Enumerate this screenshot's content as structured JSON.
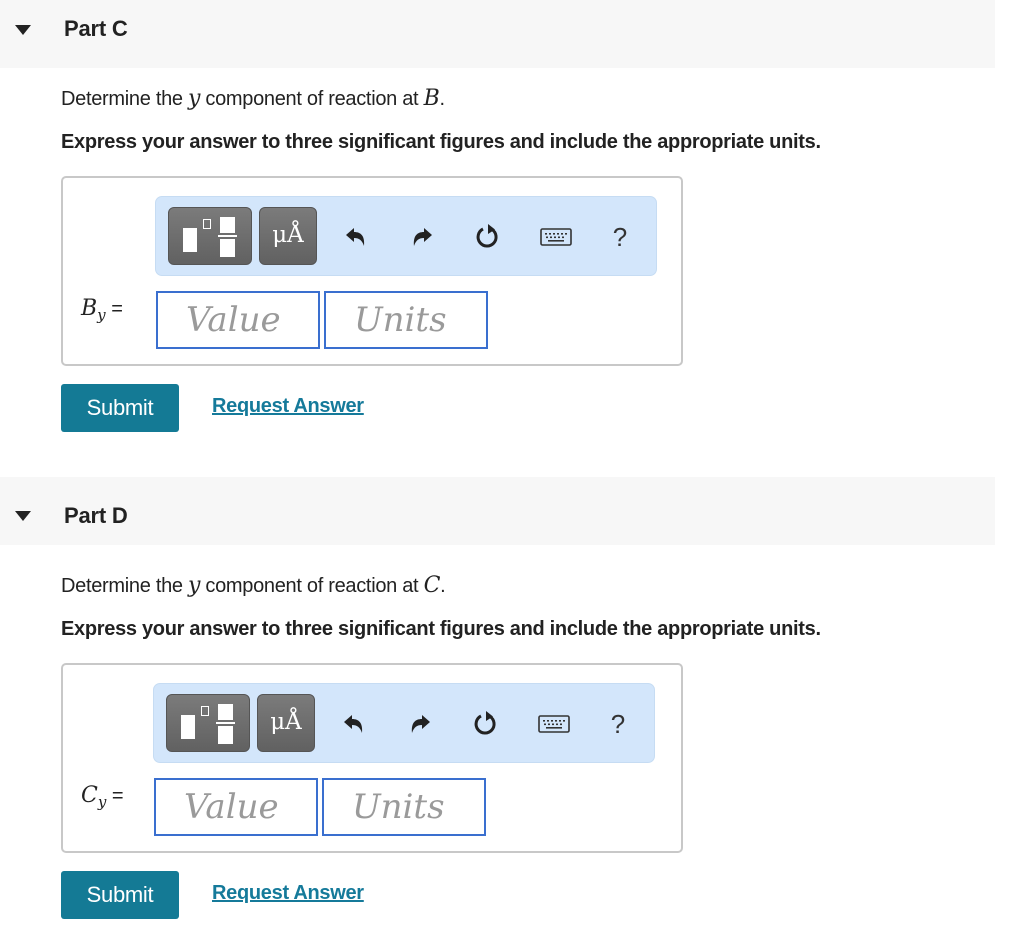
{
  "parts": [
    {
      "title": "Part C",
      "question_prefix": "Determine the ",
      "question_var": "y",
      "question_mid": " component of reaction at ",
      "question_point": "B",
      "question_suffix": ".",
      "instruction": "Express your answer to three significant figures and include the appropriate units.",
      "answer_label_var": "B",
      "answer_label_sub": "y",
      "answer_label_eq": "=",
      "value_placeholder": "Value",
      "units_placeholder": "Units",
      "submit_label": "Submit",
      "request_label": "Request Answer"
    },
    {
      "title": "Part D",
      "question_prefix": "Determine the ",
      "question_var": "y",
      "question_mid": " component of reaction at ",
      "question_point": "C",
      "question_suffix": ".",
      "instruction": "Express your answer to three significant figures and include the appropriate units.",
      "answer_label_var": "C",
      "answer_label_sub": "y",
      "answer_label_eq": "=",
      "value_placeholder": "Value",
      "units_placeholder": "Units",
      "submit_label": "Submit",
      "request_label": "Request Answer"
    }
  ],
  "toolbar": {
    "units_glyph": "μÅ",
    "help_glyph": "?",
    "icons": [
      "templates-icon",
      "units-icon",
      "undo-icon",
      "redo-icon",
      "reset-icon",
      "keyboard-icon",
      "help-icon"
    ]
  },
  "colors": {
    "submit_bg": "#147a95",
    "link": "#157a9a",
    "toolbar_bg": "#d3e6fb",
    "input_border": "#3a6fcf",
    "header_bg": "#f7f7f7"
  }
}
